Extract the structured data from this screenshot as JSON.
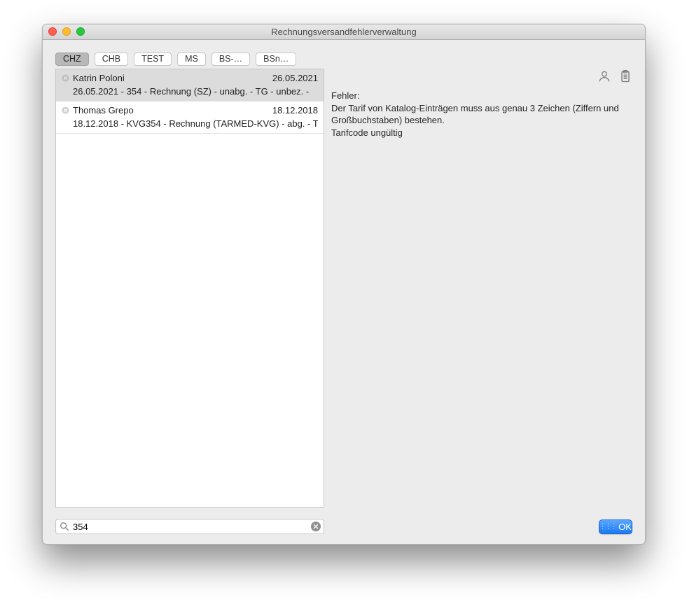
{
  "window": {
    "title": "Rechnungsversandfehlerverwaltung"
  },
  "tabs": [
    {
      "label": "CHZ",
      "active": true
    },
    {
      "label": "CHB",
      "active": false
    },
    {
      "label": "TEST",
      "active": false
    },
    {
      "label": "MS",
      "active": false
    },
    {
      "label": "BS-…",
      "active": false
    },
    {
      "label": "BSn…",
      "active": false
    }
  ],
  "list": [
    {
      "name": "Katrin Poloni",
      "date": "26.05.2021",
      "detail": "26.05.2021 - 354 - Rechnung (SZ) - unabg. - TG - unbez. -",
      "selected": true
    },
    {
      "name": "Thomas Grepo",
      "date": "18.12.2018",
      "detail": "18.12.2018 - KVG354 - Rechnung (TARMED-KVG) - abg. - T",
      "selected": false
    }
  ],
  "search": {
    "value": "354",
    "placeholder": ""
  },
  "details": {
    "heading": "Fehler:",
    "line1": "Der Tarif von Katalog-Einträgen muss aus genau 3 Zeichen (Ziffern und Großbuchstaben) bestehen.",
    "line2": "Tarifcode ungültig"
  },
  "buttons": {
    "ok": "OK"
  }
}
